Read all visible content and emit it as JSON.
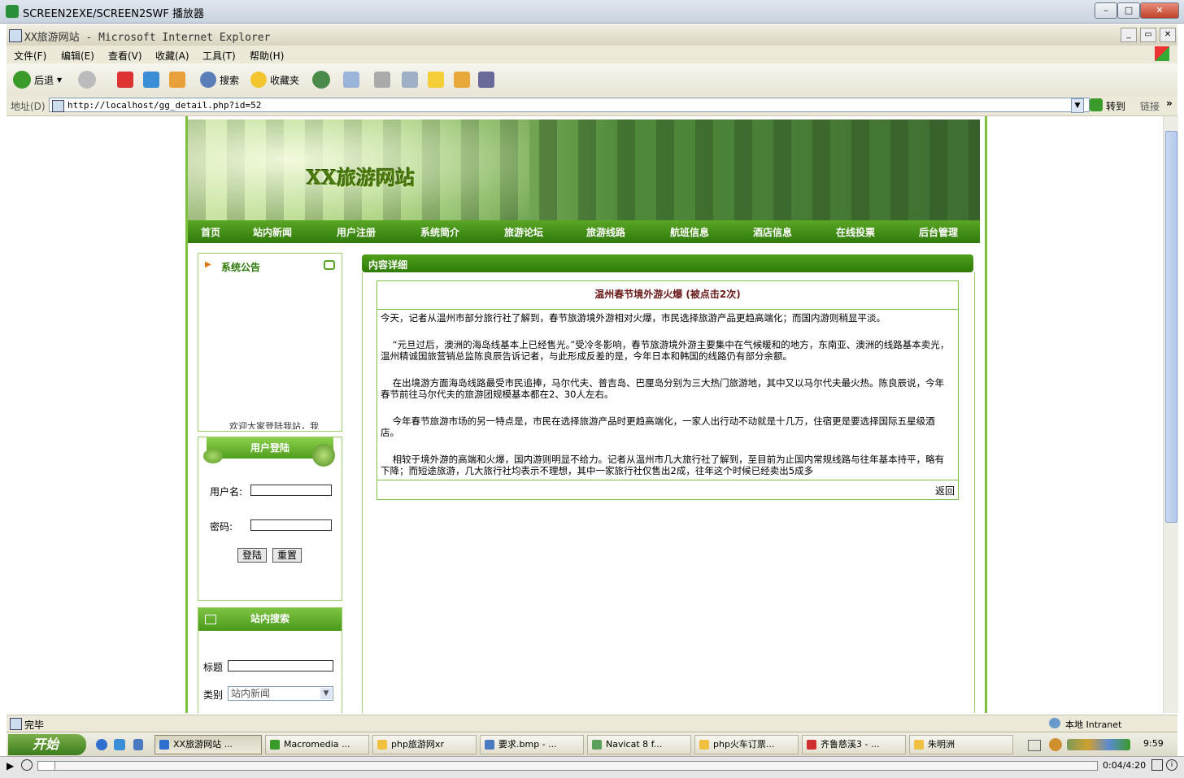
{
  "player": {
    "title": "SCREEN2EXE/SCREEN2SWF 播放器",
    "time": "0:04/4:20",
    "progress_fraction": 0.015
  },
  "ie": {
    "title": "XX旅游网站 - Microsoft Internet Explorer",
    "menu": [
      "文件(F)",
      "编辑(E)",
      "查看(V)",
      "收藏(A)",
      "工具(T)",
      "帮助(H)"
    ],
    "toolbar": {
      "back": "后退",
      "search": "搜索",
      "favorites": "收藏夹"
    },
    "address_label": "地址(D)",
    "address": "http://localhost/gg_detail.php?id=52",
    "go": "转到",
    "links": "链接",
    "status": "完毕",
    "zone": "本地 Intranet"
  },
  "site": {
    "title": "XX旅游网站",
    "nav": [
      "首页",
      "站内新闻",
      "用户注册",
      "系统简介",
      "旅游论坛",
      "旅游线路",
      "航班信息",
      "酒店信息",
      "在线投票",
      "后台管理"
    ],
    "notice": {
      "heading": "系统公告",
      "marquee": "欢迎大家登陆我站，我"
    },
    "login": {
      "heading": "用户登陆",
      "username_label": "用户名:",
      "password_label": "密码:",
      "login_button": "登陆",
      "reset_button": "重置"
    },
    "search": {
      "heading": "站内搜索",
      "title_label": "标题",
      "category_label": "类别",
      "category_value": "站内新闻"
    },
    "content": {
      "heading": "内容详细",
      "article_title": "温州春节境外游火爆 (被点击2次)",
      "paragraphs": [
        "今天，记者从温州市部分旅行社了解到，春节旅游境外游相对火爆，市民选择旅游产品更趋高端化；而国内游则稍显平淡。",
        "    “元旦过后，澳洲的海岛线基本上已经售光。”受冷冬影响，春节旅游境外游主要集中在气候暖和的地方，东南亚、澳洲的线路基本卖光，温州精诚国旅营销总监陈良辰告诉记者，与此形成反差的是，今年日本和韩国的线路仍有部分余额。",
        "    在出境游方面海岛线路最受市民追捧，马尔代夫、普吉岛、巴厘岛分别为三大热门旅游地，其中又以马尔代夫最火热。陈良辰说，今年春节前往马尔代夫的旅游团规模基本都在2、30人左右。",
        "    今年春节旅游市场的另一特点是，市民在选择旅游产品时更趋高端化，一家人出行动不动就是十几万，住宿更是要选择国际五星级酒店。",
        "    相较于境外游的高端和火爆，国内游则明显不给力。记者从温州市几大旅行社了解到，至目前为止国内常规线路与往年基本持平，略有下降；而短途旅游，几大旅行社均表示不理想，其中一家旅行社仅售出2成，往年这个时候已经卖出5成多"
      ],
      "back_link": "返回"
    }
  },
  "taskbar": {
    "start": "开始",
    "tasks": [
      "XX旅游网站 ...",
      "Macromedia ...",
      "php旅游网xr",
      "要求.bmp - ...",
      "Navicat 8 f...",
      "php火车订票...",
      "齐鲁慈溪3 - ...",
      "朱明洲"
    ],
    "clock": "9:59"
  }
}
